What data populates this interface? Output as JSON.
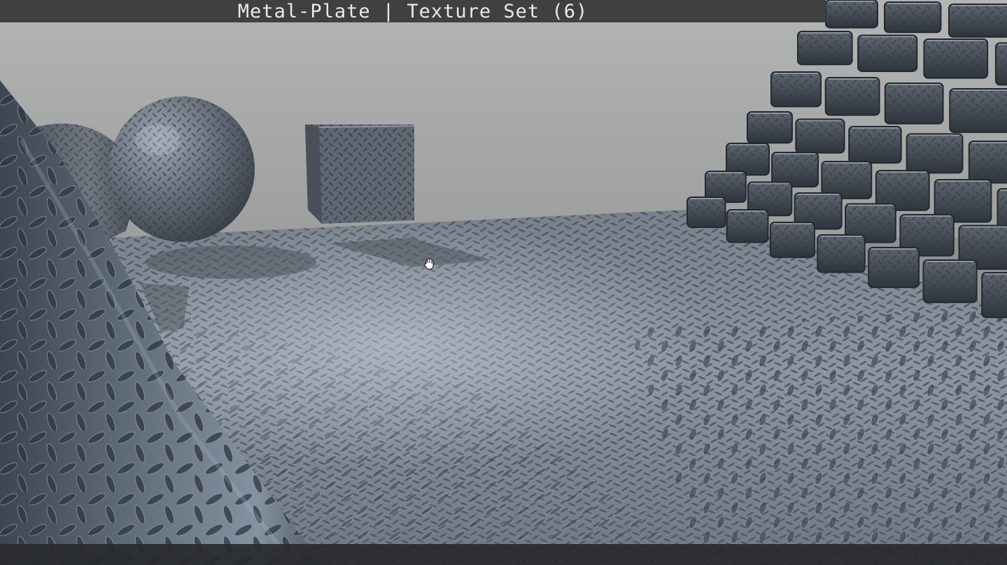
{
  "window": {
    "title": "Metal-Plate | Texture Set (6)"
  },
  "scene": {
    "objects": [
      "cone",
      "cylinder",
      "sphere",
      "cube",
      "brick-stairs",
      "floor"
    ],
    "material": "diamond-plate-metal",
    "cursor": "grab-hand-icon"
  },
  "colors": {
    "title_bar": "#3f4141",
    "title_text": "#e9e9e9",
    "backdrop": "#a7a9a8",
    "metal": "#56626f",
    "status_bar": "#282a2c"
  }
}
